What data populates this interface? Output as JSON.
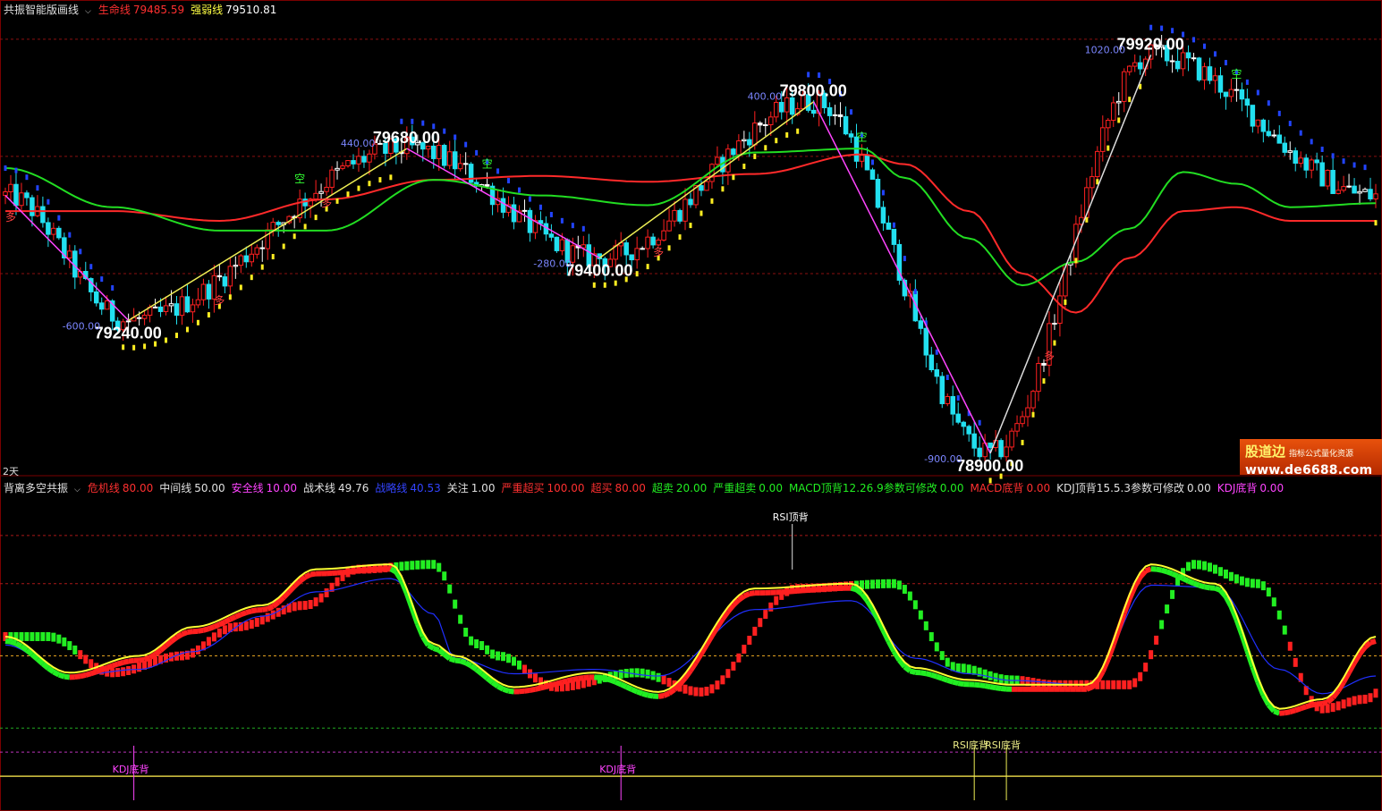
{
  "colors": {
    "background": "#000000",
    "up_candle": "#ff2020",
    "down_candle": "#22e0f0",
    "doji_candle": "#ffffff",
    "life_line": "#ff2a2a",
    "strong_weak_line": "#22dd22",
    "zigzag_up": "#eeee55",
    "zigzag_down": "#ff44ff",
    "zigzag_last": "#dddddd",
    "dashed_grid": "#8b1010",
    "kdj_red": "#ff2020",
    "kdj_green": "#22ee22",
    "osc_yellow": "#ffff33",
    "osc_blue": "#2030ff"
  },
  "top_header": {
    "title": "共振智能版画线",
    "life_line_label": "生命线",
    "life_line_value": "79485.59",
    "strong_weak_label": "强弱线",
    "strong_weak_value": "79510.81"
  },
  "bottom_header": {
    "title": "背离多空共振",
    "items": [
      {
        "label": "危机线",
        "value": "80.00",
        "color": "#ff3030"
      },
      {
        "label": "中间线",
        "value": "50.00",
        "color": "#e0e0e0"
      },
      {
        "label": "安全线",
        "value": "10.00",
        "color": "#ff44ff"
      },
      {
        "label": "战术线",
        "value": "49.76",
        "color": "#e0e0e0"
      },
      {
        "label": "战略线",
        "value": "40.53",
        "color": "#3344ff"
      },
      {
        "label": "关注",
        "value": "1.00",
        "color": "#e0e0e0"
      },
      {
        "label": "严重超买",
        "value": "100.00",
        "color": "#ff3030"
      },
      {
        "label": "超买",
        "value": "80.00",
        "color": "#ff3030"
      },
      {
        "label": "超卖",
        "value": "20.00",
        "color": "#22ee22"
      },
      {
        "label": "严重超卖",
        "value": "0.00",
        "color": "#22ee22"
      },
      {
        "label": "MACD顶背12.26.9参数可修改",
        "value": "0.00",
        "color": "#22ee22"
      },
      {
        "label": "MACD底背",
        "value": "0.00",
        "color": "#ff3030"
      },
      {
        "label": "KDJ顶背15.5.3参数可修改",
        "value": "0.00",
        "color": "#e0e0e0"
      },
      {
        "label": "KDJ底背",
        "value": "0.00",
        "color": "#ff44ff"
      }
    ]
  },
  "period_label": "2天",
  "watermark": {
    "line1": "股道边",
    "line2": "指标公式量化资源",
    "line3": "www.de6688.com"
  },
  "chart_data": [
    {
      "type": "candlestick",
      "title": "共振智能版画线",
      "ylim": [
        78870,
        80010
      ],
      "grid": "dashed horizontal",
      "pivots": [
        {
          "bar": 0,
          "price": 79560,
          "label": "",
          "diff": ""
        },
        {
          "bar": 23,
          "price": 79240,
          "label": "79240.00",
          "diff": "-600.00"
        },
        {
          "bar": 75,
          "price": 79680,
          "label": "79680.00",
          "diff": "440.00"
        },
        {
          "bar": 111,
          "price": 79400,
          "label": "79400.00",
          "diff": "-280.00"
        },
        {
          "bar": 151,
          "price": 79800,
          "label": "79800.00",
          "diff": "400.00"
        },
        {
          "bar": 184,
          "price": 78900,
          "label": "78900.00",
          "diff": "-900.00"
        },
        {
          "bar": 214,
          "price": 79920,
          "label": "79920.00",
          "diff": "1020.00"
        }
      ],
      "series": [
        {
          "name": "生命线",
          "x": [
            0,
            20,
            40,
            60,
            80,
            100,
            120,
            140,
            160,
            168,
            180,
            190,
            200,
            210,
            220,
            230,
            240,
            256
          ],
          "values": [
            79520,
            79520,
            79495,
            79550,
            79600,
            79610,
            79595,
            79615,
            79665,
            79640,
            79520,
            79360,
            79260,
            79400,
            79520,
            79530,
            79495,
            79495
          ]
        },
        {
          "name": "强弱线",
          "x": [
            0,
            20,
            40,
            60,
            80,
            100,
            120,
            140,
            160,
            168,
            180,
            190,
            200,
            210,
            220,
            230,
            240,
            256
          ],
          "values": [
            79630,
            79530,
            79470,
            79470,
            79600,
            79560,
            79535,
            79670,
            79680,
            79605,
            79450,
            79330,
            79390,
            79475,
            79620,
            79590,
            79530,
            79540
          ]
        }
      ],
      "markers": [
        {
          "bar": 1,
          "text": "多"
        },
        {
          "bar": 55,
          "text": "空"
        },
        {
          "bar": 90,
          "text": "空"
        },
        {
          "bar": 40,
          "text": "多"
        },
        {
          "bar": 60,
          "text": "多"
        },
        {
          "bar": 122,
          "text": "多"
        },
        {
          "bar": 160,
          "text": "空"
        },
        {
          "bar": 195,
          "text": "多"
        },
        {
          "bar": 230,
          "text": "空"
        }
      ]
    },
    {
      "type": "line",
      "title": "背离多空共振",
      "ylim": [
        -10,
        110
      ],
      "levels": [
        100,
        80,
        50,
        20,
        10,
        0
      ],
      "series": [
        {
          "name": "战术线",
          "x": [
            0,
            12,
            25,
            35,
            48,
            58,
            72,
            80,
            84,
            95,
            110,
            122,
            140,
            158,
            170,
            180,
            188,
            202,
            214,
            226,
            238,
            246,
            256
          ],
          "values": [
            58,
            43,
            50,
            62,
            71,
            86,
            88,
            55,
            50,
            37,
            43,
            35,
            78,
            80,
            45,
            40,
            38,
            38,
            88,
            80,
            28,
            32,
            58
          ]
        },
        {
          "name": "战略线",
          "x": [
            0,
            12,
            25,
            35,
            48,
            58,
            72,
            80,
            84,
            95,
            110,
            122,
            140,
            158,
            170,
            180,
            188,
            202,
            214,
            226,
            238,
            246,
            256
          ],
          "values": [
            56,
            42,
            45,
            53,
            69,
            80,
            86,
            70,
            50,
            43,
            45,
            42,
            72,
            76,
            50,
            43,
            40,
            38,
            83,
            82,
            45,
            34,
            42
          ]
        }
      ],
      "signals": [
        {
          "bar": 24,
          "text": "KDJ底背",
          "kind": "bottom"
        },
        {
          "bar": 115,
          "text": "KDJ底背",
          "kind": "bottom"
        },
        {
          "bar": 147,
          "text": "RSI顶背",
          "kind": "top"
        },
        {
          "bar": 181,
          "text": "RSI底背",
          "kind": "bottom"
        },
        {
          "bar": 187,
          "text": "RSI底背",
          "kind": "bottom"
        }
      ]
    }
  ]
}
